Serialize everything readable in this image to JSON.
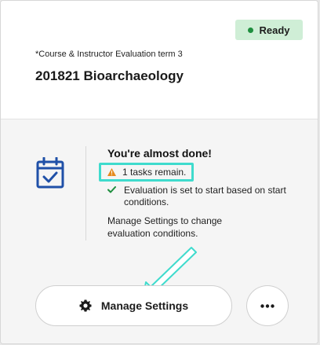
{
  "status": {
    "label": "Ready",
    "color": "#1e8e3e",
    "background": "#cfeed6"
  },
  "course": {
    "evaluation_title": "*Course & Instructor Evaluation term 3",
    "name": "201821 Bioarchaeology"
  },
  "progress": {
    "icon": "calendar-check-icon",
    "heading": "You're almost done!",
    "tasks_remaining": "1 tasks remain.",
    "completed_item": "Evaluation is set to start based on start conditions.",
    "instruction": "Manage Settings to change evaluation conditions."
  },
  "actions": {
    "manage_label": "Manage Settings",
    "manage_icon": "gear-icon",
    "more_icon": "ellipsis-icon"
  },
  "colors": {
    "accent": "#1f50a8",
    "highlight": "#3fdbcd",
    "warning": "#e58a1f",
    "success": "#1e8e3e"
  }
}
